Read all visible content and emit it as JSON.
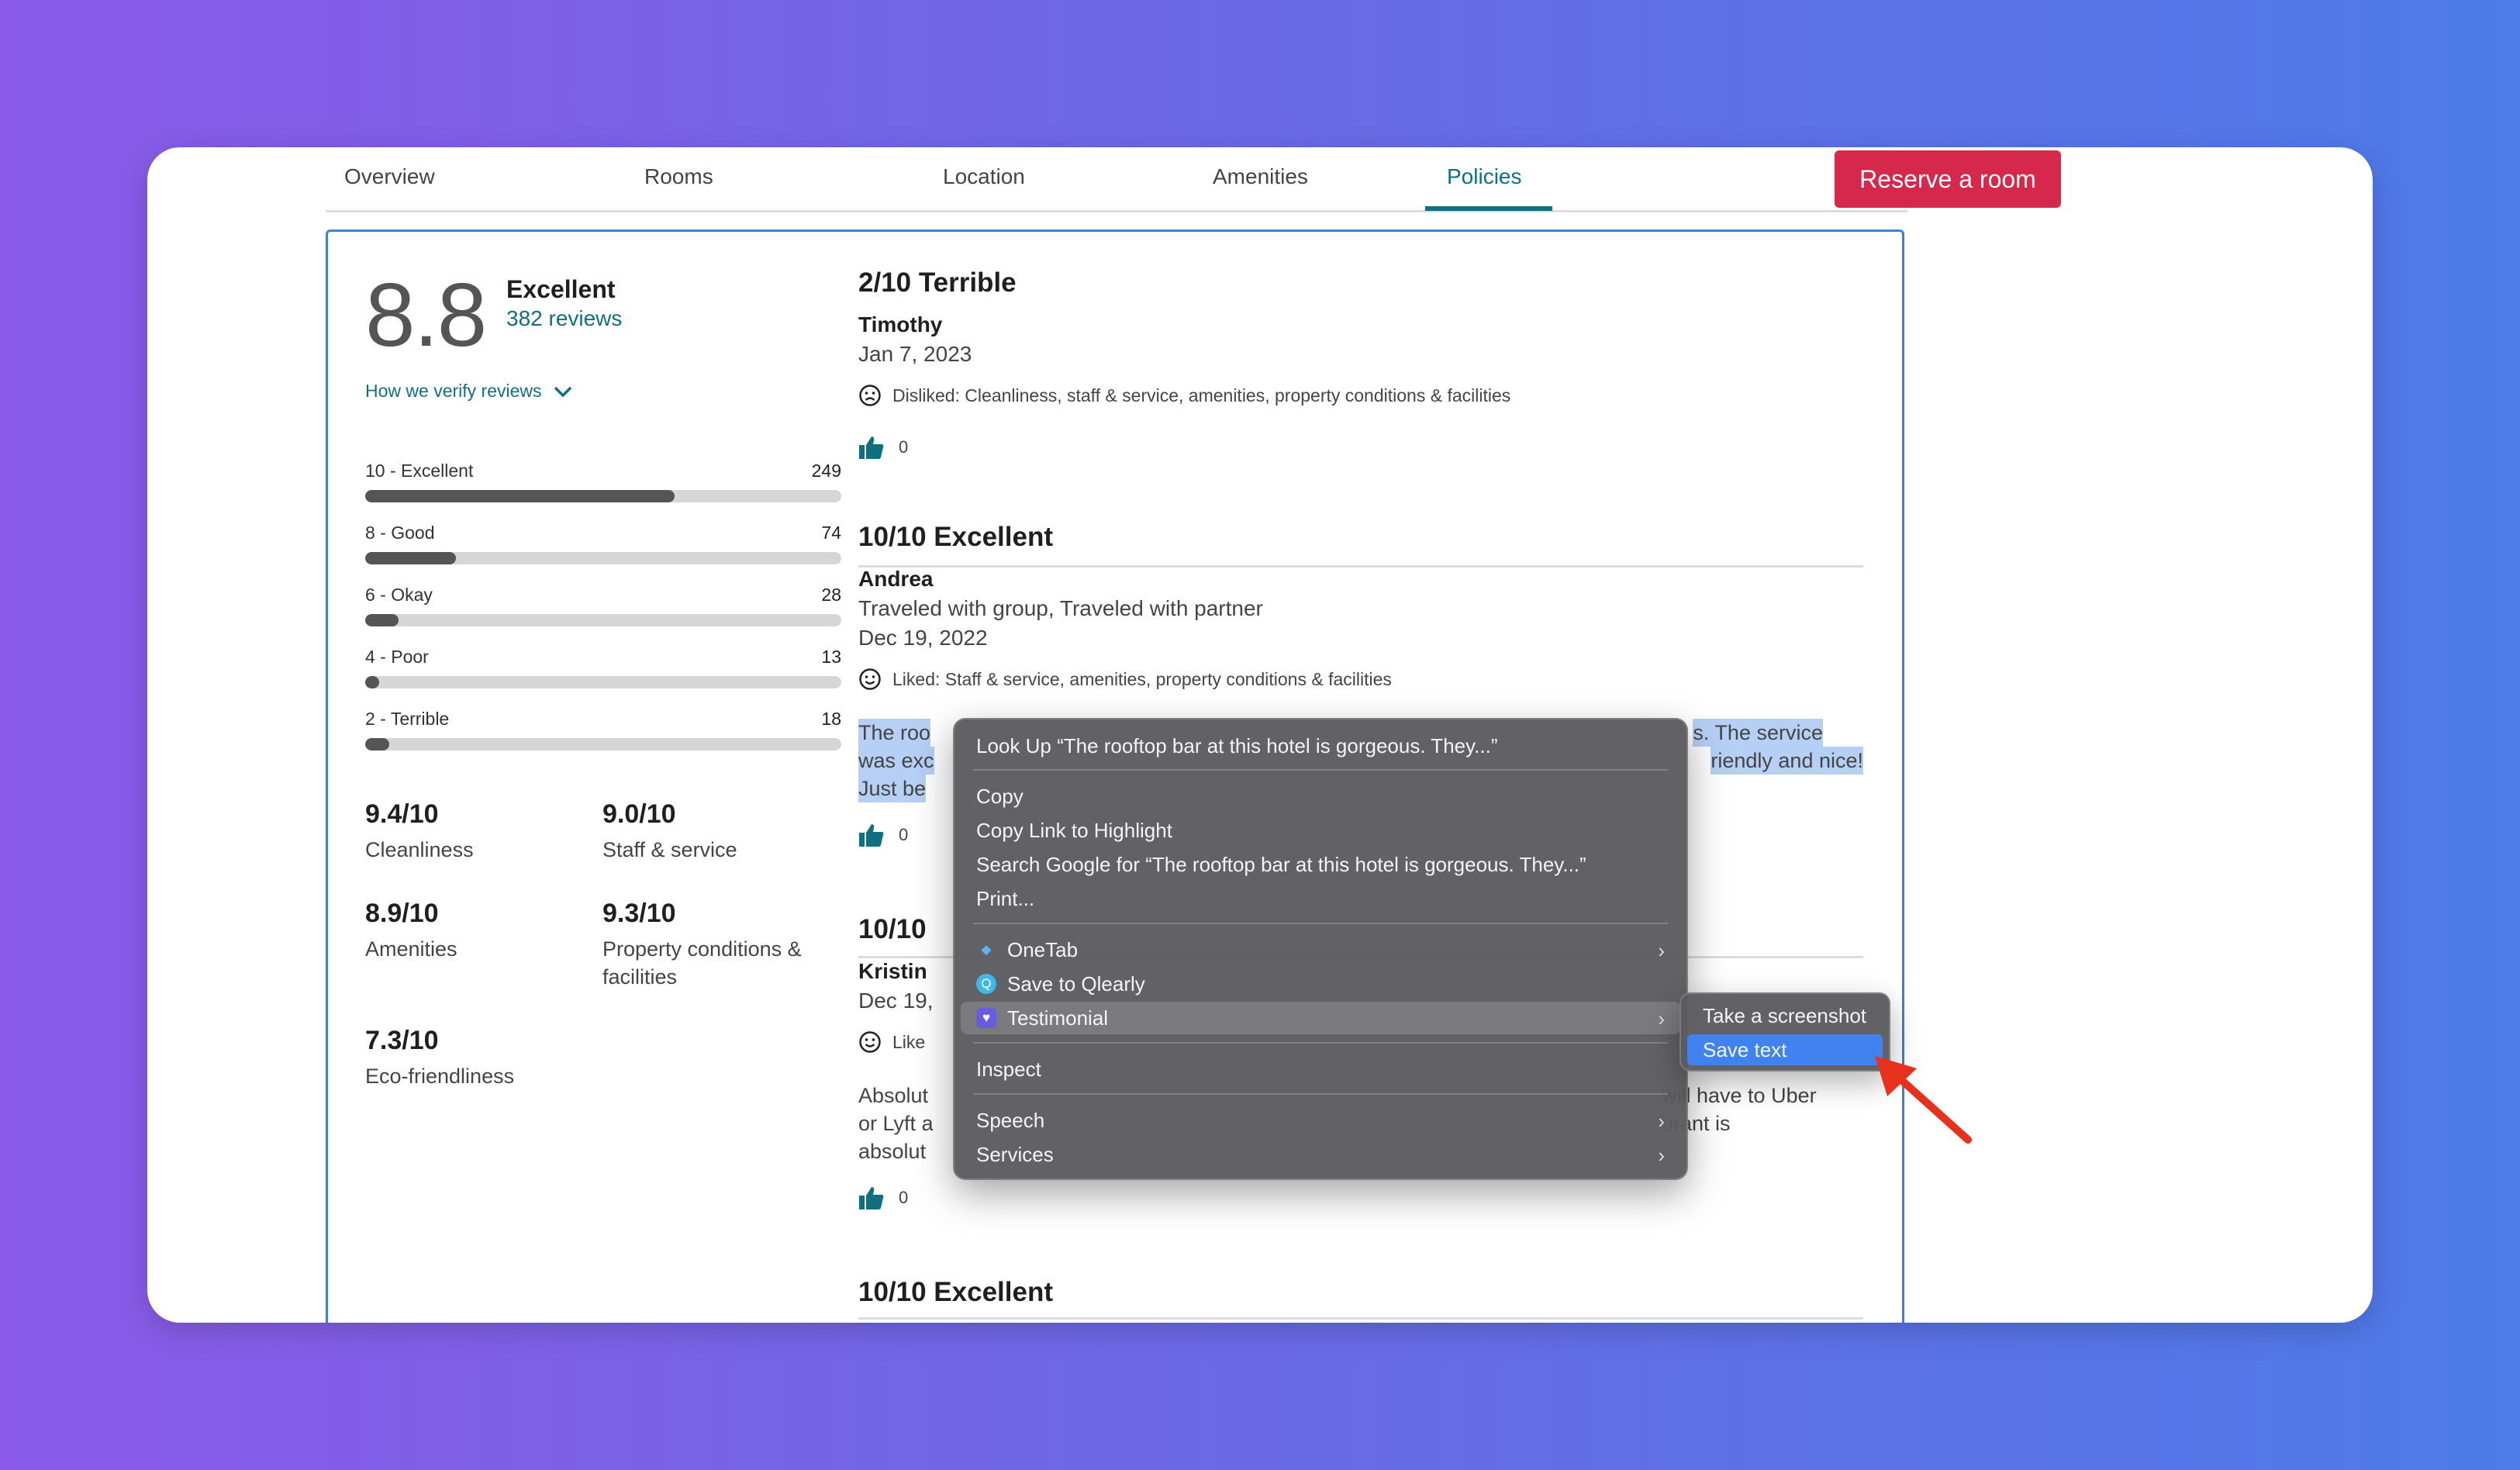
{
  "nav": {
    "tabs": [
      "Overview",
      "Rooms",
      "Location",
      "Amenities",
      "Policies"
    ],
    "active_tab": "Policies",
    "reserve_label": "Reserve a room"
  },
  "summary": {
    "score": "8.8",
    "label": "Excellent",
    "review_count": "382 reviews",
    "verify_link": "How we verify reviews",
    "distribution": [
      {
        "label": "10 - Excellent",
        "count": "249",
        "fraction": 0.65
      },
      {
        "label": "8 - Good",
        "count": "74",
        "fraction": 0.19
      },
      {
        "label": "6 - Okay",
        "count": "28",
        "fraction": 0.07
      },
      {
        "label": "4 - Poor",
        "count": "13",
        "fraction": 0.03
      },
      {
        "label": "2 - Terrible",
        "count": "18",
        "fraction": 0.05
      }
    ],
    "categories": [
      {
        "value": "9.4/10",
        "name": "Cleanliness"
      },
      {
        "value": "9.0/10",
        "name": "Staff & service"
      },
      {
        "value": "8.9/10",
        "name": "Amenities"
      },
      {
        "value": "9.3/10",
        "name": "Property conditions & facilities"
      },
      {
        "value": "7.3/10",
        "name": "Eco-friendliness"
      }
    ]
  },
  "reviews": [
    {
      "title": "2/10 Terrible",
      "author": "Timothy",
      "date": "Jan 7, 2023",
      "sentiment": "Disliked: Cleanliness, staff & service, amenities, property conditions & facilities",
      "helpful": "0"
    },
    {
      "title": "10/10 Excellent",
      "author": "Andrea",
      "traveled": "Traveled with group, Traveled with partner",
      "date": "Dec 19, 2022",
      "sentiment": "Liked: Staff & service, amenities, property conditions & facilities",
      "body_line1_start": "The roo",
      "body_line1_end": "s. The service",
      "body_line2_start": "was exc",
      "body_line2_end": "riendly and nice!",
      "body_line3_start": "Just be",
      "helpful": "0"
    },
    {
      "title": "10/10",
      "author": "Kristin",
      "date": "Dec 19,",
      "sentiment": "Like",
      "body_line1_start": "Absolut",
      "body_line1_end": "will have to Uber",
      "body_line2_start": "or Lyft a",
      "body_line2_end": "urant is",
      "body_line3_start": "absolut",
      "helpful": "0"
    },
    {
      "title": "10/10 Excellent"
    }
  ],
  "context_menu": {
    "look_up": "Look Up “The rooftop bar at this hotel is gorgeous. They...”",
    "copy": "Copy",
    "copy_link": "Copy Link to Highlight",
    "search_google": "Search Google for “The rooftop bar at this hotel is gorgeous. They...”",
    "print": "Print...",
    "onetab": "OneTab",
    "qlearly": "Save to Qlearly",
    "testimonial": "Testimonial",
    "inspect": "Inspect",
    "speech": "Speech",
    "services": "Services"
  },
  "submenu": {
    "screenshot": "Take a screenshot",
    "save_text": "Save text"
  },
  "colors": {
    "accent": "#10707f",
    "reserve": "#d6284b",
    "selection": "#b6cff5",
    "menu_active": "#3f82f0",
    "arrow": "#e8311d"
  }
}
